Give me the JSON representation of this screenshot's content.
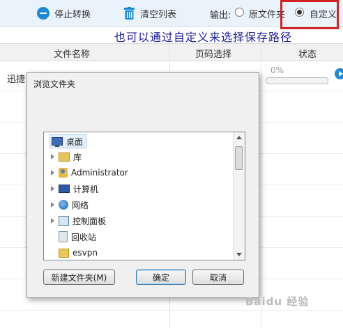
{
  "toolbar": {
    "stop_label": "停止转换",
    "clear_label": "清空列表",
    "output_label": "输出:",
    "radio_source_label": "原文件夹",
    "radio_custom_label": "自定义",
    "selected_output": "自定义",
    "accent_color": "#1e88d8",
    "highlight_color": "#d32222"
  },
  "annotation": "也可以通过自定义来选择保存路径",
  "table": {
    "headers": [
      "文件名称",
      "页码选择",
      "状态"
    ],
    "rows": [
      {
        "name": "迅捷",
        "progress_text": "0%",
        "progress": 0
      }
    ]
  },
  "dialog": {
    "title": "浏览文件夹",
    "tree": [
      {
        "label": "桌面",
        "icon": "desktop-icon"
      },
      {
        "label": "库",
        "icon": "library-icon"
      },
      {
        "label": "Administrator",
        "icon": "user-folder-icon"
      },
      {
        "label": "计算机",
        "icon": "computer-icon"
      },
      {
        "label": "网络",
        "icon": "network-icon"
      },
      {
        "label": "控制面板",
        "icon": "control-panel-icon"
      },
      {
        "label": "回收站",
        "icon": "recycle-bin-icon"
      },
      {
        "label": "esvpn",
        "icon": "folder-icon"
      }
    ],
    "selected": "桌面",
    "buttons": {
      "new_folder": "新建文件夹(M)",
      "ok": "确定",
      "cancel": "取消"
    }
  },
  "watermark": "Baidu 经验"
}
